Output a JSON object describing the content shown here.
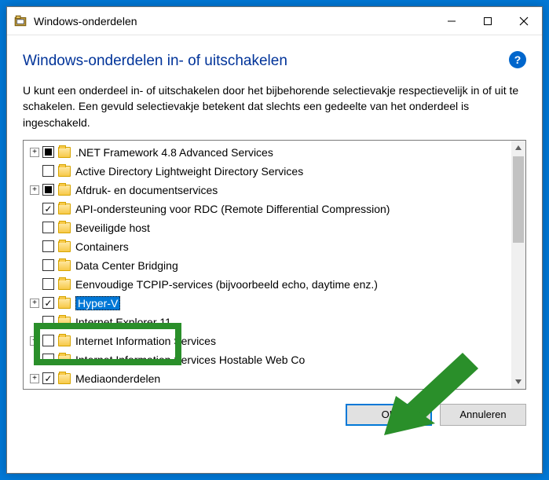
{
  "window": {
    "title": "Windows-onderdelen",
    "heading": "Windows-onderdelen in- of uitschakelen",
    "description": "U kunt een onderdeel in- of uitschakelen door het bijbehorende selectievakje respectievelijk in of uit te schakelen. Een gevuld selectievakje betekent dat slechts een gedeelte van het onderdeel is ingeschakeld."
  },
  "items": [
    {
      "expand": "+",
      "state": "filled",
      "label": ".NET Framework 4.8 Advanced Services"
    },
    {
      "expand": "",
      "state": "none",
      "label": "Active Directory Lightweight Directory Services"
    },
    {
      "expand": "+",
      "state": "filled",
      "label": "Afdruk- en documentservices"
    },
    {
      "expand": "",
      "state": "checked",
      "label": "API-ondersteuning voor RDC (Remote Differential Compression)"
    },
    {
      "expand": "",
      "state": "none",
      "label": "Beveiligde host"
    },
    {
      "expand": "",
      "state": "none",
      "label": "Containers"
    },
    {
      "expand": "",
      "state": "none",
      "label": "Data Center Bridging"
    },
    {
      "expand": "",
      "state": "none",
      "label": "Eenvoudige TCPIP-services (bijvoorbeeld echo, daytime enz.)"
    },
    {
      "expand": "+",
      "state": "checked",
      "label": "Hyper-V",
      "selected": true
    },
    {
      "expand": "",
      "state": "none",
      "label": "Internet Explorer 11"
    },
    {
      "expand": "+",
      "state": "none",
      "label": "Internet Information Services"
    },
    {
      "expand": "",
      "state": "none",
      "label": "Internet Information Services Hostable Web Co"
    },
    {
      "expand": "+",
      "state": "checked",
      "label": "Mediaonderdelen"
    }
  ],
  "buttons": {
    "ok": "OK",
    "cancel": "Annuleren"
  },
  "help_symbol": "?"
}
